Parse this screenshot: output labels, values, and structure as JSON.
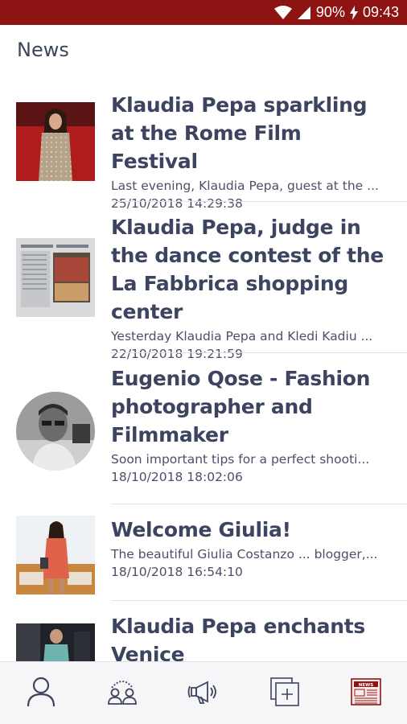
{
  "status": {
    "battery": "90%",
    "time": "09:43"
  },
  "header": {
    "title": "News"
  },
  "news": [
    {
      "title": "Klaudia Pepa sparkling at the Rome Film Festival",
      "snippet": "Last evening, Klaudia Pepa, guest at the ...",
      "date": "25/10/2018 14:29:38"
    },
    {
      "title": "Klaudia Pepa, judge in the dance contest of the La Fabbrica shopping center",
      "snippet": "Yesterday Klaudia Pepa and Kledi Kadiu ...",
      "date": "22/10/2018 19:21:59"
    },
    {
      "title": "Eugenio Qose - Fashion photographer and Filmmaker",
      "snippet": "Soon important tips for a perfect shooti...",
      "date": "18/10/2018 18:02:06"
    },
    {
      "title": "Welcome Giulia!",
      "snippet": "The beautiful Giulia Costanzo ... blogger,...",
      "date": "18/10/2018 16:54:10"
    },
    {
      "title": "Klaudia Pepa enchants Venice",
      "snippet": "",
      "date": ""
    }
  ],
  "nav": {
    "icons": [
      "person-icon",
      "group-icon",
      "megaphone-icon",
      "add-gallery-icon",
      "newspaper-icon"
    ],
    "active_color": "#8e1414",
    "newspaper_label": "NEWS"
  },
  "colors": {
    "accent": "#8e1414",
    "text": "#3d4460"
  }
}
